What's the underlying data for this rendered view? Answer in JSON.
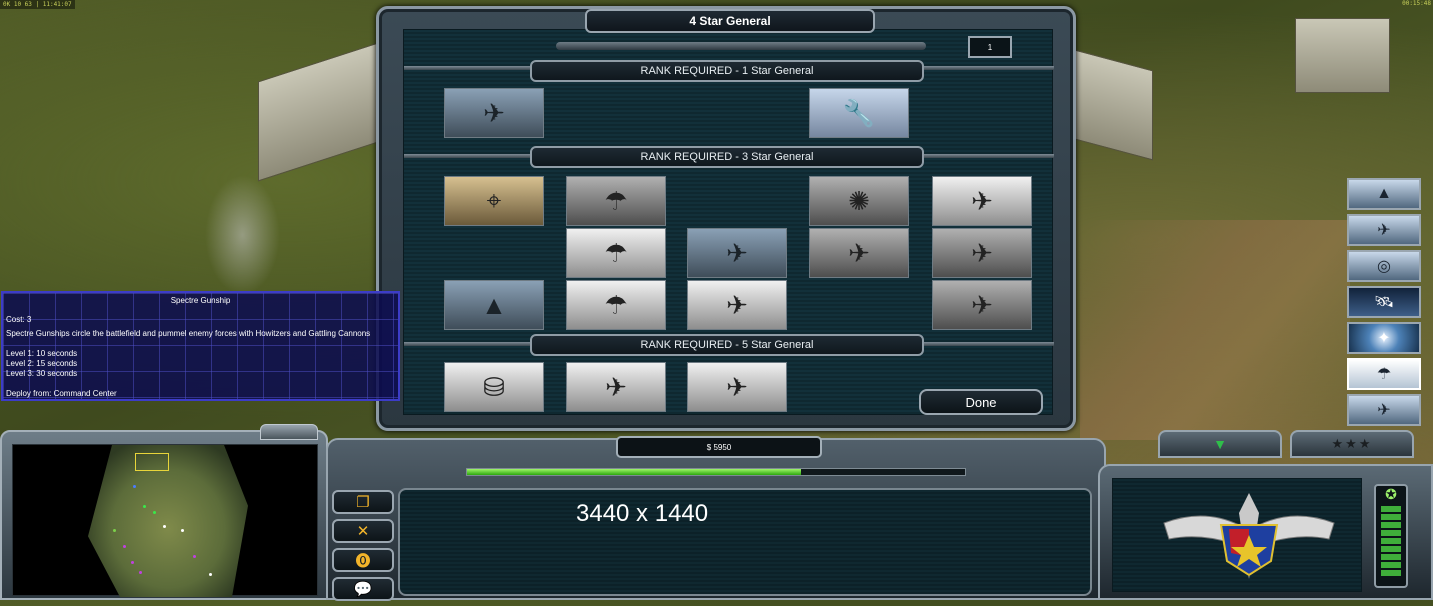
{
  "hud_top": {
    "left_text": "0K 10 63 | 11:41:07",
    "right_text": "00:15:48"
  },
  "dialog": {
    "title": "4 Star General",
    "points_available": "1",
    "done_label": "Done",
    "ranks": [
      {
        "label": "RANK REQUIRED - 1 Star General"
      },
      {
        "label": "RANK REQUIRED - 3 Star General"
      },
      {
        "label": "RANK REQUIRED - 5 Star General"
      }
    ],
    "icons": {
      "drone": "drone-icon",
      "repair": "wrench-icon",
      "sniper": "soldier-icon",
      "paradrop": "parachute-icon",
      "jet": "jet-icon",
      "explosion": "explosion-icon",
      "bomber": "bomber-icon",
      "supply": "supply-drop-icon",
      "cargo_plane": "cargo-plane-icon"
    }
  },
  "tooltip": {
    "title": "Spectre Gunship",
    "cost": "Cost: 3",
    "description": "Spectre Gunships circle the battlefield and pummel enemy forces with Howitzers and Gattling Cannons",
    "level1": "Level 1: 10 seconds",
    "level2": "Level 2: 15 seconds",
    "level3": "Level 3: 30 seconds",
    "deploy": "Deploy from: Command Center"
  },
  "hud": {
    "money": "$ 5950",
    "power_fraction": 0.67,
    "resolution_label": "3440 x 1440"
  },
  "colors": {
    "tooltip_bg": "#0a0a50",
    "tooltip_border": "#3c3cc8",
    "power_green": "#2da80f"
  }
}
